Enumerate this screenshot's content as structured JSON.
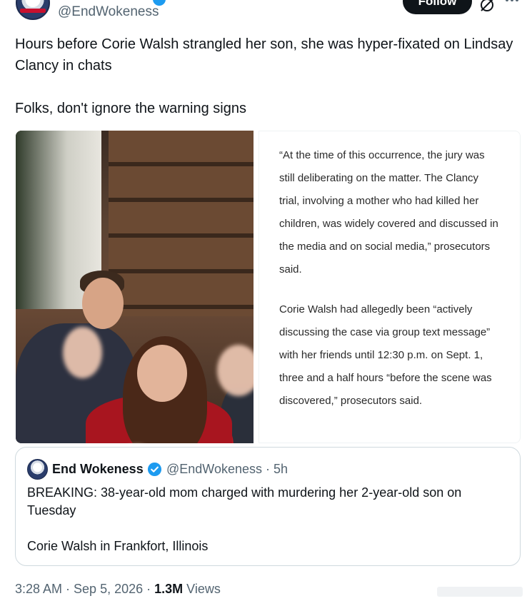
{
  "header": {
    "handle": "@EndWokeness",
    "follow_label": "Follow"
  },
  "tweet": {
    "line1": "Hours before Corie Walsh strangled her son, she was hyper-fixated on Lindsay Clancy in chats",
    "line2": "Folks, don't ignore the warning signs"
  },
  "quote_card": {
    "para1": "“At the time of this occurrence, the jury was still deliberating on the matter. The Clancy trial, involving a mother who had killed her children, was widely covered and discussed in the media and on social media,” prosecutors said.",
    "para2": "Corie Walsh had allegedly been “actively discussing the case via group text message” with her friends until 12:30 p.m. on Sept. 1, three and a half hours “before the scene was discovered,” prosecutors said."
  },
  "quoted_tweet": {
    "name": "End Wokeness",
    "handle_time": "@EndWokeness · 5h",
    "text1": "BREAKING: 38-year-old mom charged with murdering her 2-year-old son on Tuesday",
    "text2": "Corie Walsh in Frankfort, Illinois"
  },
  "meta": {
    "time_date": "3:28 AM · Sep 5, 2026 · ",
    "views_count": "1.3M",
    "views_label": " Views"
  },
  "colors": {
    "verified": "#1d9bf0",
    "text": "#0f1419",
    "secondary": "#536471",
    "border": "#cfd9de"
  },
  "icons": [
    "verified-badge-icon",
    "grok-icon",
    "more-icon"
  ]
}
